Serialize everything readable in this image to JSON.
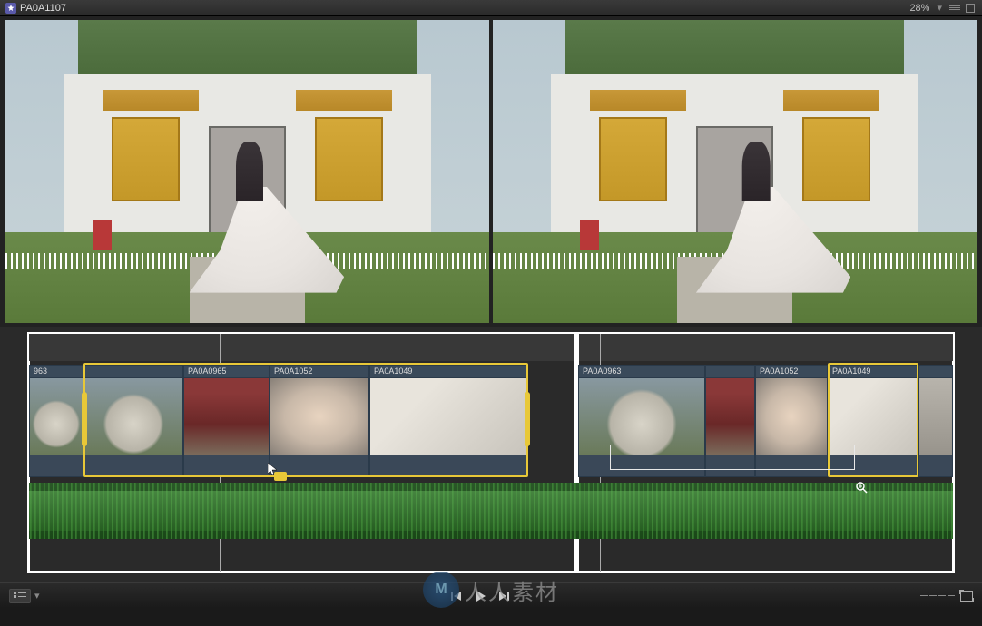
{
  "header": {
    "title": "PA0A1107",
    "zoom_level": "28%"
  },
  "timeline": {
    "clips_left": [
      {
        "label": "963"
      },
      {
        "label": ""
      },
      {
        "label": "PA0A0965"
      },
      {
        "label": "PA0A1052"
      },
      {
        "label": "PA0A1049"
      }
    ],
    "clips_right": [
      {
        "label": "PA0A0963"
      },
      {
        "label": ""
      },
      {
        "label": "PA0A1052"
      },
      {
        "label": "PA0A1049"
      }
    ]
  },
  "watermark": {
    "logo_text": "M",
    "text": "人人素材"
  }
}
